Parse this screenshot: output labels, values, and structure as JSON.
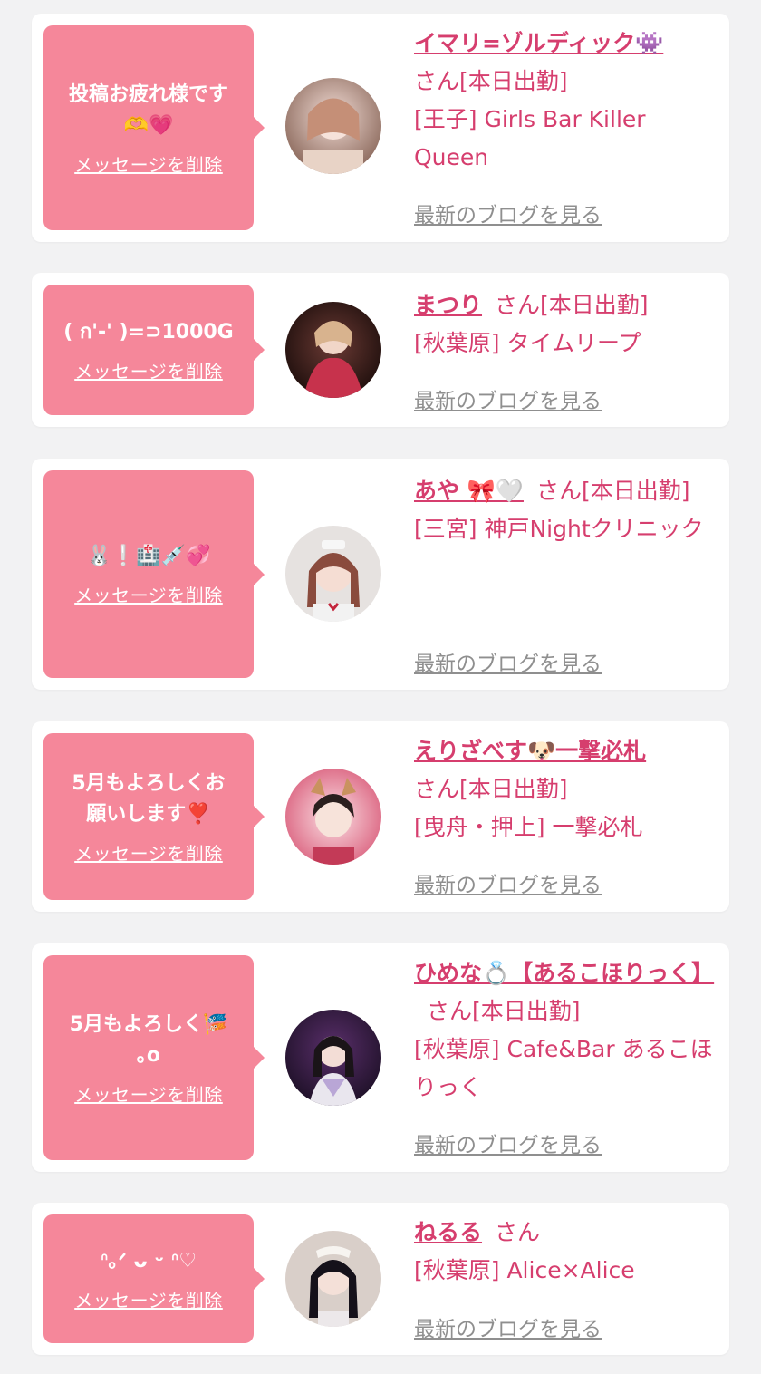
{
  "delete_label": "メッセージを削除",
  "blog_label": "最新のブログを見る",
  "accent_color": "#d63e6e",
  "bubble_color": "#f5879a",
  "entries": [
    {
      "message": "投稿お疲れ様です\n🫶💗",
      "name": "イマリ=ゾルディック👾",
      "honorific": "さん[本日出勤]",
      "store": "[王子] Girls Bar Killer Queen"
    },
    {
      "message": "( ก'-' )=⊃1000G",
      "name": "まつり",
      "honorific": "さん[本日出勤]",
      "store": "[秋葉原] タイムリープ"
    },
    {
      "message": "🐰❕🏥💉💞",
      "name": "あや 🎀🤍",
      "honorific": "さん[本日出勤]",
      "store": "[三宮] 神戸Nightクリニック"
    },
    {
      "message": "5月もよろしくお\n願いします❣️",
      "name": "えりざべす🐶一撃必札",
      "honorific": "さん[本日出勤]",
      "store": "[曳舟・押上] 一撃必札"
    },
    {
      "message": "5月もよろしく🎏\n｡o",
      "name": "ひめな💍【あるこほりっく】",
      "honorific": "さん[本日出勤]",
      "store": "[秋葉原] Cafe&Bar あるこほりっく"
    },
    {
      "message": "ᐢ｡ᐟ  ᴗ ᵕ ᐢ♡",
      "name": "ねるる",
      "honorific": "さん",
      "store": "[秋葉原] Alice×Alice"
    }
  ]
}
